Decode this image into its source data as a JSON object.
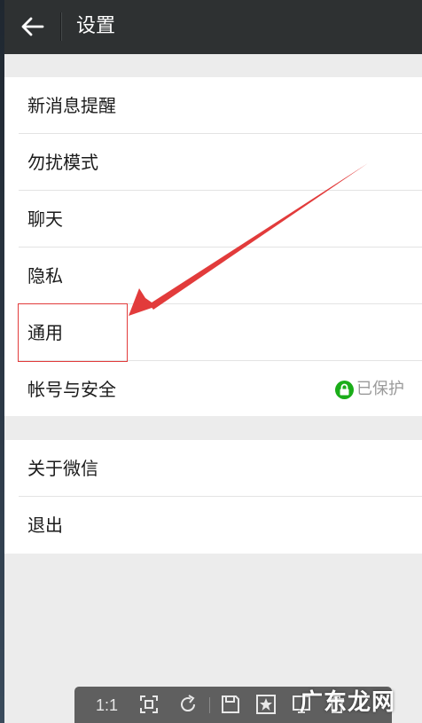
{
  "header": {
    "title": "设置",
    "back_icon": "back-arrow-icon"
  },
  "settings": {
    "group1": [
      {
        "label": "新消息提醒"
      },
      {
        "label": "勿扰模式"
      },
      {
        "label": "聊天"
      },
      {
        "label": "隐私"
      },
      {
        "label": "通用"
      },
      {
        "label": "帐号与安全",
        "status": "已保护",
        "status_icon": "lock-icon"
      }
    ],
    "group2": [
      {
        "label": "关于微信"
      },
      {
        "label": "退出"
      }
    ]
  },
  "annotation": {
    "highlighted_item": "通用",
    "color": "#e23b3b"
  },
  "viewer_toolbar": {
    "zoom_label": "1:1",
    "icons": [
      "fit-screen-icon",
      "rotate-icon",
      "save-icon",
      "favorite-icon",
      "fullscreen-icon",
      "delete-icon"
    ]
  },
  "watermark": {
    "text": "广东龙网"
  },
  "colors": {
    "titlebar": "#2e3132",
    "background": "#ececec",
    "accent_green": "#1aad19",
    "annotation_red": "#e23b3b"
  }
}
